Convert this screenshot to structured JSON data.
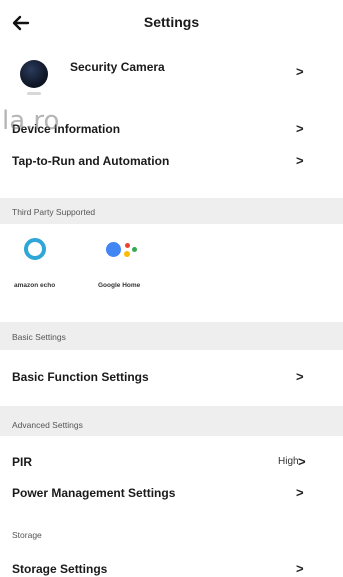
{
  "header": {
    "title": "Settings",
    "back_icon": "arrow-left-icon"
  },
  "device": {
    "name": "Security Camera"
  },
  "rows_top": [
    {
      "label": "Device Information"
    },
    {
      "label": "Tap-to-Run and Automation"
    }
  ],
  "third_party": {
    "section_label": "Third Party Supported",
    "alexa_caption": "amazon echo",
    "google_caption": "Google Home"
  },
  "basic": {
    "section_label": "Basic Settings",
    "row_label": "Basic Function Settings"
  },
  "advanced": {
    "section_label": "Advanced Settings",
    "pir_label": "PIR",
    "pir_value": "High",
    "power_label": "Power Management Settings"
  },
  "storage": {
    "section_label": "Storage",
    "row_label": "Storage Settings"
  },
  "chevron": ">",
  "watermark": "la.ro",
  "colors": {
    "alexa_blue": "#2fa6d8",
    "google_blue": "#4285f4",
    "google_red": "#ea4335",
    "google_yellow": "#fbbc05",
    "google_green": "#34a853",
    "section_bg": "#eeeeef"
  }
}
